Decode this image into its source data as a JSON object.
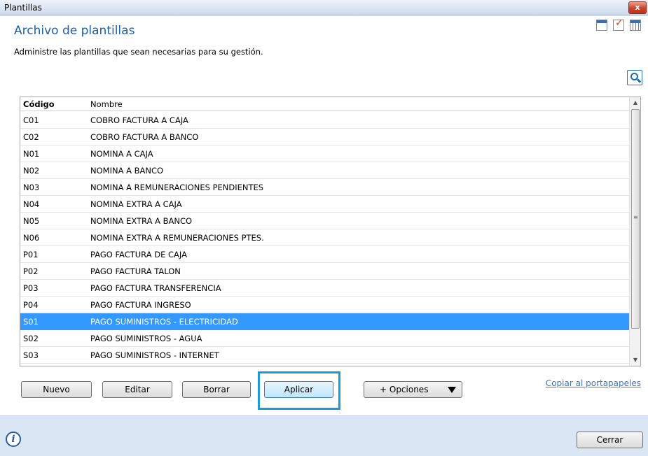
{
  "window": {
    "title": "Plantillas",
    "close_label": "x"
  },
  "header": {
    "title": "Archivo de plantillas",
    "subtitle": "Administre las plantillas que sean necesarias para su gestión."
  },
  "toolbar_icons": [
    "calendar-icon",
    "checklist-icon",
    "grid-calendar-icon",
    "search-icon"
  ],
  "table": {
    "columns": [
      "Código",
      "Nombre"
    ],
    "rows": [
      {
        "code": "C01",
        "name": "COBRO FACTURA A CAJA"
      },
      {
        "code": "C02",
        "name": "COBRO FACTURA A BANCO"
      },
      {
        "code": "N01",
        "name": "NOMINA A CAJA"
      },
      {
        "code": "N02",
        "name": "NOMINA A BANCO"
      },
      {
        "code": "N03",
        "name": "NOMINA A REMUNERACIONES PENDIENTES"
      },
      {
        "code": "N04",
        "name": "NOMINA EXTRA A CAJA"
      },
      {
        "code": "N05",
        "name": "NOMINA EXTRA A BANCO"
      },
      {
        "code": "N06",
        "name": "NOMINA EXTRA A REMUNERACIONES PTES."
      },
      {
        "code": "P01",
        "name": "PAGO FACTURA DE CAJA"
      },
      {
        "code": "P02",
        "name": "PAGO FACTURA TALON"
      },
      {
        "code": "P03",
        "name": "PAGO FACTURA TRANSFERENCIA"
      },
      {
        "code": "P04",
        "name": "PAGO FACTURA INGRESO"
      },
      {
        "code": "S01",
        "name": "PAGO SUMINISTROS - ELECTRICIDAD"
      },
      {
        "code": "S02",
        "name": "PAGO SUMINISTROS - AGUA"
      },
      {
        "code": "S03",
        "name": "PAGO SUMINISTROS - INTERNET"
      }
    ],
    "selected_code": "S01"
  },
  "buttons": {
    "nuevo": "Nuevo",
    "editar": "Editar",
    "borrar": "Borrar",
    "aplicar": "Aplicar",
    "opciones": "+ Opciones",
    "copiar": "Copiar al portapapeles",
    "cerrar": "Cerrar"
  },
  "colors": {
    "accent": "#1f5fa9",
    "selection": "#3399ff",
    "highlight": "#1a9bd7"
  }
}
